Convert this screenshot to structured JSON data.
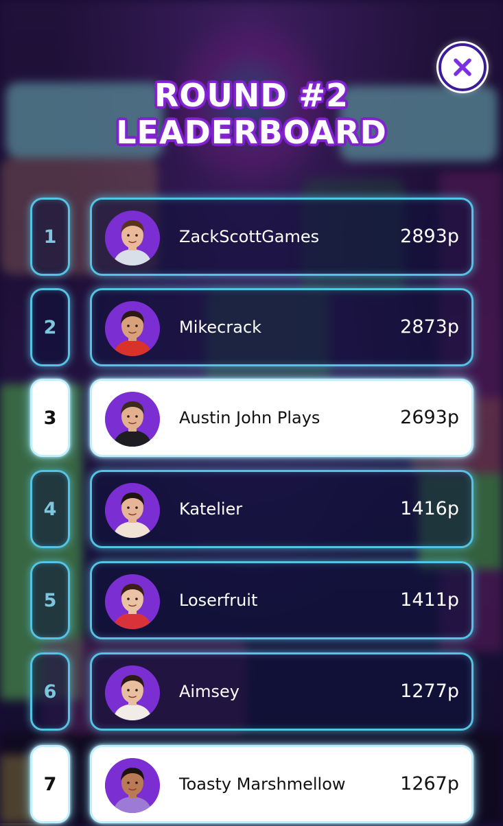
{
  "header": {
    "title_line1": "ROUND #2",
    "title_line2": "LEADERBOARD"
  },
  "close_button": {
    "icon": "close-icon"
  },
  "leaderboard": [
    {
      "rank": "1",
      "name": "ZackScottGames",
      "score": "2893p",
      "highlighted": false,
      "avatar": {
        "bg": "#7b2fd3",
        "skin": "#e9b99a",
        "hair": "#5a3320",
        "shirt": "#d8dfe8"
      }
    },
    {
      "rank": "2",
      "name": "Mikecrack",
      "score": "2873p",
      "highlighted": false,
      "avatar": {
        "bg": "#7b2fd3",
        "skin": "#d9a07c",
        "hair": "#2a1a12",
        "shirt": "#d8322b"
      }
    },
    {
      "rank": "3",
      "name": "Austin John Plays",
      "score": "2693p",
      "highlighted": true,
      "avatar": {
        "bg": "#7b2fd3",
        "skin": "#e3b08f",
        "hair": "#3a2a20",
        "shirt": "#1d1d22"
      }
    },
    {
      "rank": "4",
      "name": "Katelier",
      "score": "1416p",
      "highlighted": false,
      "avatar": {
        "bg": "#7b2fd3",
        "skin": "#e6b496",
        "hair": "#1e1410",
        "shirt": "#f1e2d6"
      }
    },
    {
      "rank": "5",
      "name": "Loserfruit",
      "score": "1411p",
      "highlighted": false,
      "avatar": {
        "bg": "#7b2fd3",
        "skin": "#ecc2a4",
        "hair": "#3b1f17",
        "shirt": "#d9323a"
      }
    },
    {
      "rank": "6",
      "name": "Aimsey",
      "score": "1277p",
      "highlighted": false,
      "avatar": {
        "bg": "#7b2fd3",
        "skin": "#e8bea0",
        "hair": "#2d1a14",
        "shirt": "#f2ece6"
      }
    },
    {
      "rank": "7",
      "name": "Toasty Marshmellow",
      "score": "1267p",
      "highlighted": true,
      "avatar": {
        "bg": "#7b2fd3",
        "skin": "#b97a55",
        "hair": "#1c120e",
        "shirt": "#9c7ad6"
      }
    }
  ],
  "colors": {
    "title_fill": "#ffffff",
    "title_outline": "#9b34e8",
    "row_glow": "#55c3e3",
    "rank_number_dark_row": "#7ec6de",
    "avatar_ring": "#7b2fd3"
  }
}
